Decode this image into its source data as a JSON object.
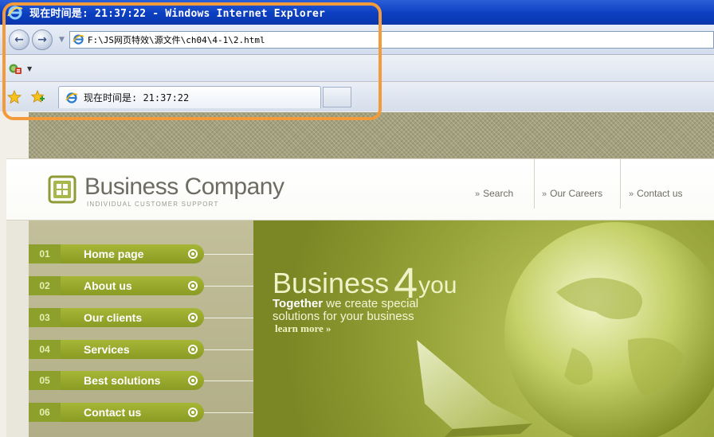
{
  "browser": {
    "title": "现在时间是: 21:37:22 - Windows Internet Explorer",
    "address": "F:\\JS网页特效\\源文件\\ch04\\4-1\\2.html",
    "tab_title": "现在时间是: 21:37:22",
    "icons": {
      "back": "back-arrow-icon",
      "forward": "forward-arrow-icon",
      "page": "ie-page-icon",
      "favorites": "favorites-star-icon",
      "add_favorites": "add-favorites-icon",
      "feeds": "feeds-icon"
    }
  },
  "site": {
    "brand": "Business Company",
    "tagline": "INDIVIDUAL CUSTOMER SUPPORT",
    "top_links": [
      {
        "label": "Search"
      },
      {
        "label": "Our Careers"
      },
      {
        "label": "Contact us"
      }
    ],
    "link_prefix": "»",
    "menu": [
      {
        "num": "01",
        "label": "Home page"
      },
      {
        "num": "02",
        "label": "About us"
      },
      {
        "num": "03",
        "label": "Our clients"
      },
      {
        "num": "04",
        "label": "Services"
      },
      {
        "num": "05",
        "label": "Best solutions"
      },
      {
        "num": "06",
        "label": "Contact us"
      }
    ],
    "banner": {
      "title": "Business",
      "title_num": "4",
      "title_suffix": "you",
      "line1_bold": "Together",
      "line1_rest": " we create special",
      "line2": "solutions for your business",
      "learn_more": "learn more »"
    }
  },
  "colors": {
    "title_bar": "#0b3ec0",
    "highlight": "#f39a3a",
    "menu_green": "#8ea02c",
    "banner_green": "#98a53a"
  }
}
